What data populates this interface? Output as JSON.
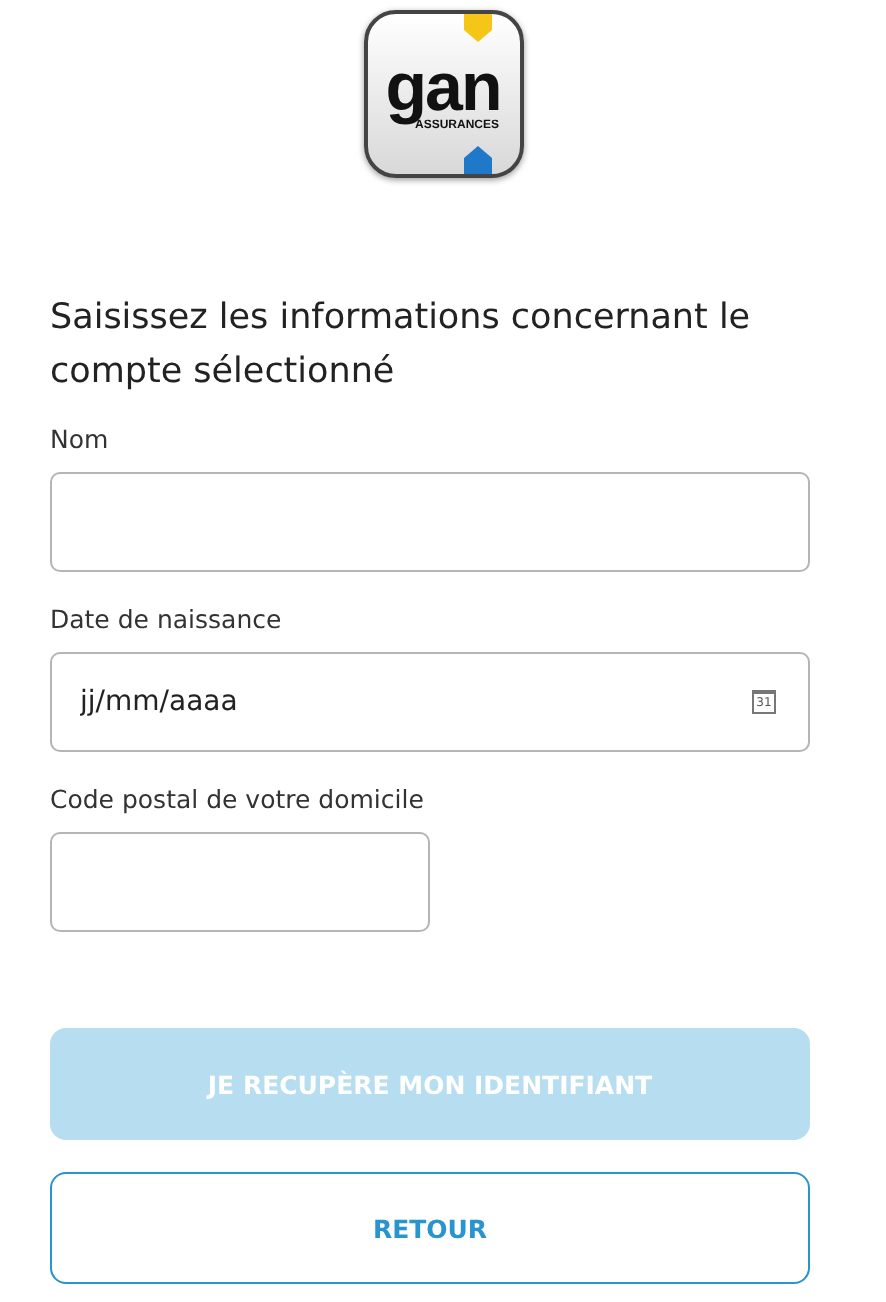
{
  "logo": {
    "wordmark": "gan",
    "tagline": "ASSURANCES"
  },
  "heading": "Saisissez les informations concernant le compte sélectionné",
  "fields": [
    {
      "kind": "text",
      "label": "Nom"
    },
    {
      "kind": "date",
      "label": "Date de naissance",
      "placeholder": "jj/mm/aaaa",
      "calendar_day": "31"
    },
    {
      "kind": "postal",
      "label": "Code postal de votre domicile"
    }
  ],
  "buttons": [
    {
      "kind": "primary",
      "label": "JE RECUPÈRE MON IDENTIFIANT",
      "disabled": true
    },
    {
      "kind": "outline",
      "label": "RETOUR",
      "disabled": false
    }
  ]
}
